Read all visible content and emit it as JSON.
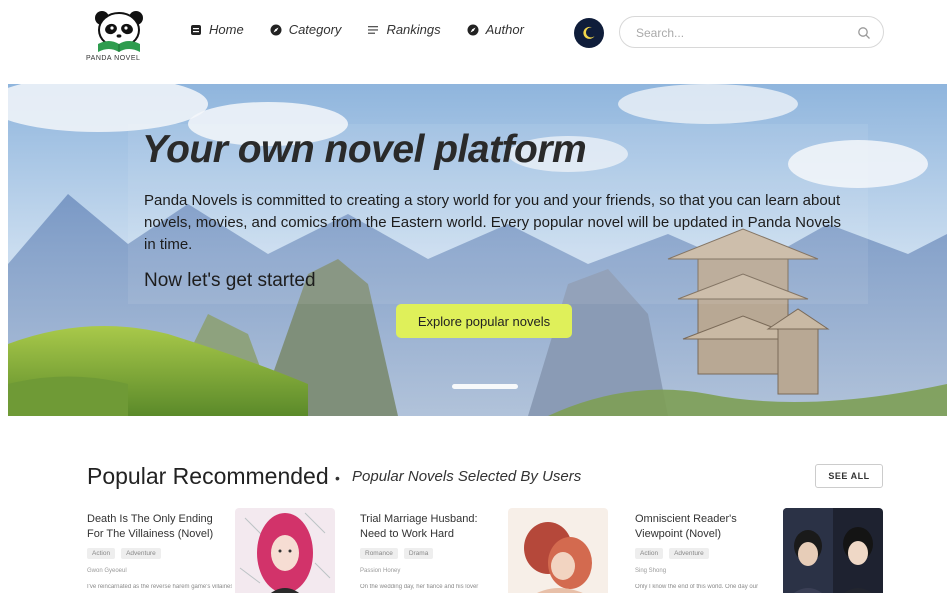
{
  "header": {
    "logo_text": "PANDA NOVEL",
    "nav": [
      {
        "label": "Home",
        "icon": "home-icon"
      },
      {
        "label": "Category",
        "icon": "compass-icon"
      },
      {
        "label": "Rankings",
        "icon": "list-icon"
      },
      {
        "label": "Author",
        "icon": "compass-icon"
      }
    ],
    "dark_mode_icon": "moon-icon",
    "search": {
      "placeholder": "Search...",
      "value": ""
    }
  },
  "hero": {
    "title": "Your own novel platform",
    "description": "Panda Novels is committed to creating a story world for you and your friends, so that you can learn about novels, movies, and comics from the Eastern world. Every popular novel will be updated in Panda Novels in time.",
    "cta_text": "Now let's get started",
    "button_label": "Explore popular novels",
    "accent_color": "#dff05a"
  },
  "popular": {
    "title": "Popular Recommended",
    "separator": "•",
    "subtitle": "Popular Novels Selected By Users",
    "see_all": "SEE ALL",
    "cards": [
      {
        "title": "Death Is The Only Ending For The Villainess (Novel)",
        "tags": [
          "Action",
          "Adventure"
        ],
        "author": "Gwon Gyeoeul",
        "snippet": "I've reincarnated as the reverse harem game's villainess"
      },
      {
        "title": "Trial Marriage Husband: Need to Work Hard",
        "tags": [
          "Romance",
          "Drama"
        ],
        "author": "Passion Honey",
        "snippet": "On the wedding day, her fiancé and his lover"
      },
      {
        "title": "Omniscient Reader's Viewpoint (Novel)",
        "tags": [
          "Action",
          "Adventure"
        ],
        "author": "Sing Shong",
        "snippet": "Only I know the end of this world. One day our"
      }
    ]
  }
}
